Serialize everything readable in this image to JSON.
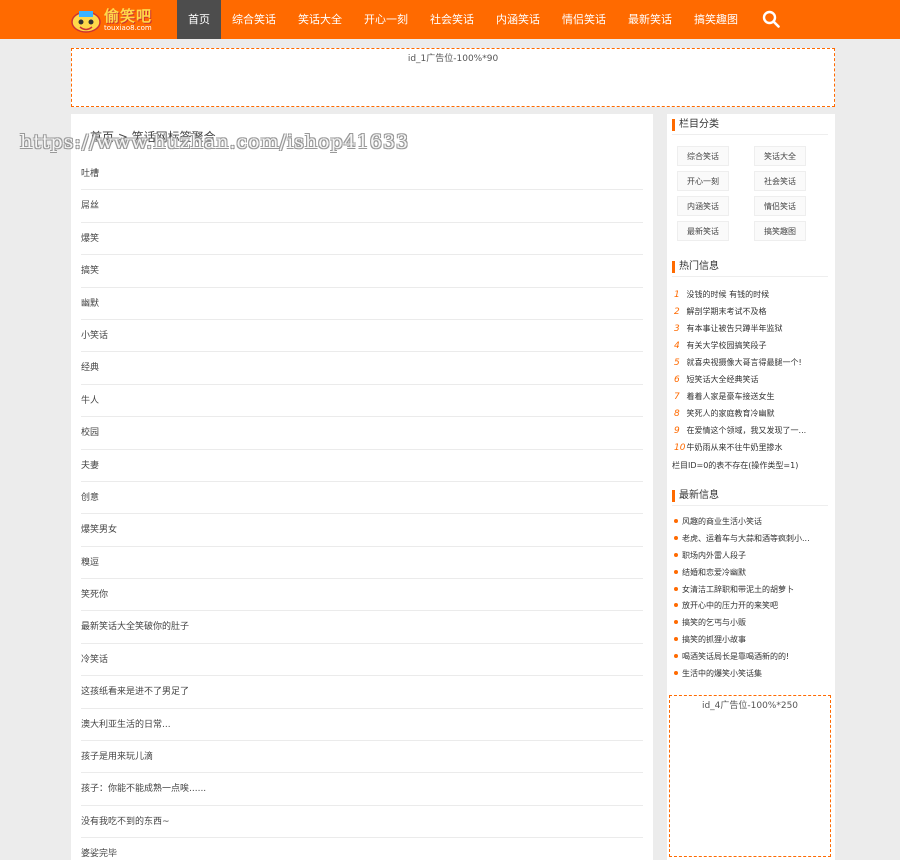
{
  "brand": {
    "name": "偷笑吧",
    "domain": "touxiao8.com"
  },
  "nav": {
    "items": [
      "首页",
      "综合笑话",
      "笑话大全",
      "开心一刻",
      "社会笑话",
      "内涵笑话",
      "情侣笑话",
      "最新笑话",
      "搞笑趣图"
    ],
    "active_index": 0,
    "search_icon": "search-icon"
  },
  "ads": {
    "top": "id_1广告位-100%*90",
    "side": "id_4广告位-100%*250"
  },
  "breadcrumb": "首页 > 笑话网标签聚合",
  "watermark": "https://www.huzhan.com/ishop41633",
  "tags": [
    "吐槽",
    "屌丝",
    "爆笑",
    "搞笑",
    "幽默",
    "小笑话",
    "经典",
    "牛人",
    "校园",
    "夫妻",
    "创意",
    "爆笑男女",
    "糗逗",
    "笑死你",
    "最新笑话大全笑破你的肚子",
    "冷笑话",
    "这孩纸看来是进不了男足了",
    "澳大利亚生活的日常...",
    "孩子是用来玩儿滴",
    "孩子：你能不能成熟一点唉......",
    "没有我吃不到的东西~",
    "婆娑完毕"
  ],
  "sidebar": {
    "categories_title": "栏目分类",
    "categories": [
      "综合笑话",
      "笑话大全",
      "开心一刻",
      "社会笑话",
      "内涵笑话",
      "情侣笑话",
      "最新笑话",
      "搞笑趣图"
    ],
    "hot_title": "热门信息",
    "hot": [
      "没钱的时候 有钱的时候",
      "解剖学期末考试不及格",
      "有本事让被告只蹲半年监狱",
      "有关大学校园搞笑段子",
      "就喜央视摄像大哥言得最腿一个!",
      "短笑话大全经典笑话",
      "着着人家是豪车接送女生",
      "笑死人的家庭教育冷幽默",
      "在爱情这个领域，我又发现了一...",
      "牛奶雨从来不往牛奶里掺水"
    ],
    "hot_error": "栏目ID=0的表不存在(操作类型=1)",
    "new_title": "最新信息",
    "new": [
      "风趣的商业生活小笑话",
      "老虎、运着车与大蒜和酒等疯刺小...",
      "职场内外雷人段子",
      "结婚和恋爱冷幽默",
      "女清洁工辞职和带泥土的胡萝卜",
      "放开心中的压力开的来笑吧",
      "搞笑的乞丐与小贩",
      "搞笑的抓狸小故事",
      "喝酒笑话局长是靠喝酒新的的!",
      "生活中的爆笑小笑话集"
    ]
  },
  "colors": {
    "accent": "#ff6a00",
    "nav_active": "#4d4d4d",
    "background": "#ececec"
  }
}
